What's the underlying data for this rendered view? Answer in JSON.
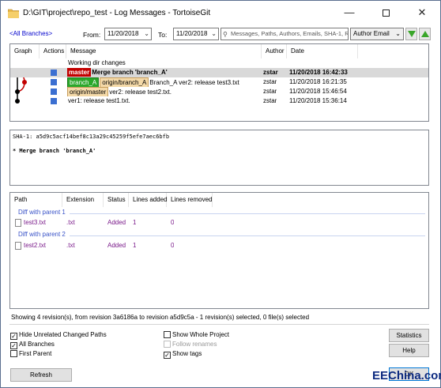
{
  "window": {
    "title": "D:\\GIT\\project\\repo_test - Log Messages - TortoiseGit",
    "min_glyph": "—",
    "close_glyph": "✕"
  },
  "filters": {
    "all_branches": "<All Branches>",
    "from_label": "From:",
    "from_date": "11/20/2018",
    "to_label": "To:",
    "to_date": "11/20/2018",
    "search_placeholder": "Messages, Paths, Authors, Emails, SHA-1, Re",
    "search_field": "Author Email"
  },
  "log": {
    "columns": [
      "Graph",
      "Actions",
      "Message",
      "Author",
      "Date"
    ],
    "working_dir": "Working dir changes",
    "rows": [
      {
        "refs": [
          "master"
        ],
        "message": "Merge branch 'branch_A'",
        "author": "zstar",
        "date": "11/20/2018 16:42:33"
      },
      {
        "refs": [
          "branch_A",
          "origin/branch_A"
        ],
        "message": "Branch_A ver2: release test3.txt",
        "author": "zstar",
        "date": "11/20/2018 16:21:35"
      },
      {
        "refs": [
          "origin/master"
        ],
        "message": "ver2: release test2.txt.",
        "author": "zstar",
        "date": "11/20/2018 15:46:54"
      },
      {
        "refs": [],
        "message": "ver1: release test1.txt.",
        "author": "zstar",
        "date": "11/20/2018 15:36:14"
      }
    ]
  },
  "detail": {
    "sha": "SHA-1: a5d9c5acf14bef8c13a29c45259f5efe7aec6bfb",
    "message": "* Merge branch 'branch_A'"
  },
  "files": {
    "columns": [
      "Path",
      "Extension",
      "Status",
      "Lines added",
      "Lines removed"
    ],
    "groups": [
      {
        "label": "Diff with parent 1",
        "rows": [
          {
            "path": "test3.txt",
            "ext": ".txt",
            "status": "Added",
            "added": "1",
            "removed": "0"
          }
        ]
      },
      {
        "label": "Diff with parent 2",
        "rows": [
          {
            "path": "test2.txt",
            "ext": ".txt",
            "status": "Added",
            "added": "1",
            "removed": "0"
          }
        ]
      }
    ]
  },
  "status_text": "Showing 4 revision(s), from revision 3a6186a to revision a5d9c5a - 1 revision(s) selected, 0 file(s) selected",
  "options": {
    "hide_unrelated": {
      "label": "Hide Unrelated Changed Paths",
      "checked": true
    },
    "all_branches": {
      "label": "All Branches",
      "checked": true
    },
    "first_parent": {
      "label": "First Parent",
      "checked": false
    },
    "show_whole_project": {
      "label": "Show Whole Project",
      "checked": false
    },
    "follow_renames": {
      "label": "Follow renames",
      "checked": false
    },
    "show_tags": {
      "label": "Show tags",
      "checked": true
    }
  },
  "buttons": {
    "refresh": "Refresh",
    "statistics": "Statistics",
    "help": "Help",
    "ok": "OK"
  },
  "watermark": "EEChina.com",
  "colors": {
    "master_tag": "#c20000",
    "branch_tag": "#2aa72a",
    "remote_tag": "#f4d9a8",
    "link": "#0000cc",
    "group_label": "#3a53c8",
    "file_text": "#7a1a8a"
  }
}
